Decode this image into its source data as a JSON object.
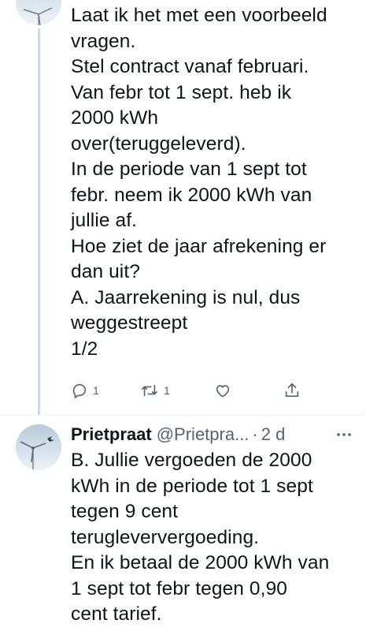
{
  "tweet1": {
    "lines": [
      "Laat ik het met een voorbeeld",
      "vragen.",
      "Stel contract vanaf februari.",
      "Van febr tot 1 sept. heb ik",
      "2000 kWh",
      "over(teruggeleverd).",
      "In de periode van 1 sept tot",
      "febr. neem ik 2000 kWh van",
      "jullie af.",
      "Hoe ziet de jaar afrekening er",
      "dan uit?",
      "A. Jaarrekening is nul, dus",
      "weggestreept",
      "1/2"
    ],
    "actions": {
      "reply_count": "1",
      "retweet_count": "1"
    }
  },
  "tweet2": {
    "display_name": "Prietpraat",
    "handle": "@Prietpra...",
    "separator": "·",
    "time": "2 d",
    "more_label": "···",
    "lines": [
      "B. Jullie vergoeden de 2000",
      "kWh in de periode tot 1 sept",
      "tegen 9 cent",
      "terugleververgoeding.",
      "En ik betaal de 2000 kWh van",
      "1 sept tot febr tegen 0,90",
      "cent tarief."
    ]
  },
  "colors": {
    "text": "#0f1419",
    "secondary": "#536471",
    "thread_line": "#cfd9de",
    "divider": "#eff3f4"
  },
  "icons": {
    "reply": "reply-icon",
    "retweet": "retweet-icon",
    "like": "like-icon",
    "share": "share-icon",
    "more": "more-icon"
  }
}
